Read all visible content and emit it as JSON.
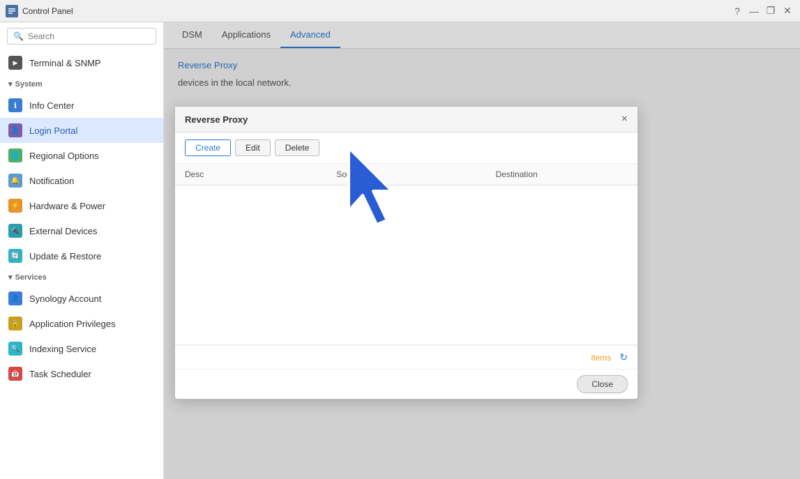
{
  "titleBar": {
    "title": "Control Panel",
    "questionBtn": "?",
    "minimizeBtn": "—",
    "restoreBtn": "❐",
    "closeBtn": "✕"
  },
  "sidebar": {
    "searchPlaceholder": "Search",
    "sections": [
      {
        "type": "item",
        "label": "Terminal & SNMP",
        "iconColor": "icon-terminal",
        "iconChar": "▶"
      }
    ],
    "systemHeader": "System",
    "systemItems": [
      {
        "label": "Info Center",
        "iconColor": "icon-blue",
        "iconChar": "ℹ",
        "active": false
      },
      {
        "label": "Login Portal",
        "iconColor": "icon-purple",
        "iconChar": "👤",
        "active": true
      },
      {
        "label": "Regional Options",
        "iconColor": "icon-green",
        "iconChar": "🌐",
        "active": false
      },
      {
        "label": "Notification",
        "iconColor": "icon-blue-light",
        "iconChar": "🔔",
        "active": false
      },
      {
        "label": "Hardware & Power",
        "iconColor": "icon-orange",
        "iconChar": "⚡",
        "active": false
      },
      {
        "label": "External Devices",
        "iconColor": "icon-teal",
        "iconChar": "🔌",
        "active": false
      },
      {
        "label": "Update & Restore",
        "iconColor": "icon-cyan",
        "iconChar": "🔄",
        "active": false
      }
    ],
    "servicesHeader": "Services",
    "serviceItems": [
      {
        "label": "Synology Account",
        "iconColor": "icon-blue",
        "iconChar": "👤",
        "active": false
      },
      {
        "label": "Application Privileges",
        "iconColor": "icon-gold",
        "iconChar": "🔒",
        "active": false
      },
      {
        "label": "Indexing Service",
        "iconColor": "icon-cyan",
        "iconChar": "🔍",
        "active": false
      },
      {
        "label": "Task Scheduler",
        "iconColor": "icon-calendar",
        "iconChar": "📅",
        "active": false
      }
    ]
  },
  "tabs": [
    {
      "label": "DSM",
      "active": false
    },
    {
      "label": "Applications",
      "active": false
    },
    {
      "label": "Advanced",
      "active": true
    }
  ],
  "breadcrumb": "Reverse Proxy",
  "contentDesc": "devices in the local network.",
  "dialog": {
    "title": "Reverse Proxy",
    "closeBtn": "×",
    "createBtn": "Create",
    "editBtn": "Edit",
    "deleteBtn": "Delete",
    "columns": {
      "description": "Desc",
      "source": "Source",
      "destination": "Destination"
    },
    "itemsLabel": "items",
    "closeLabel": "Close"
  }
}
